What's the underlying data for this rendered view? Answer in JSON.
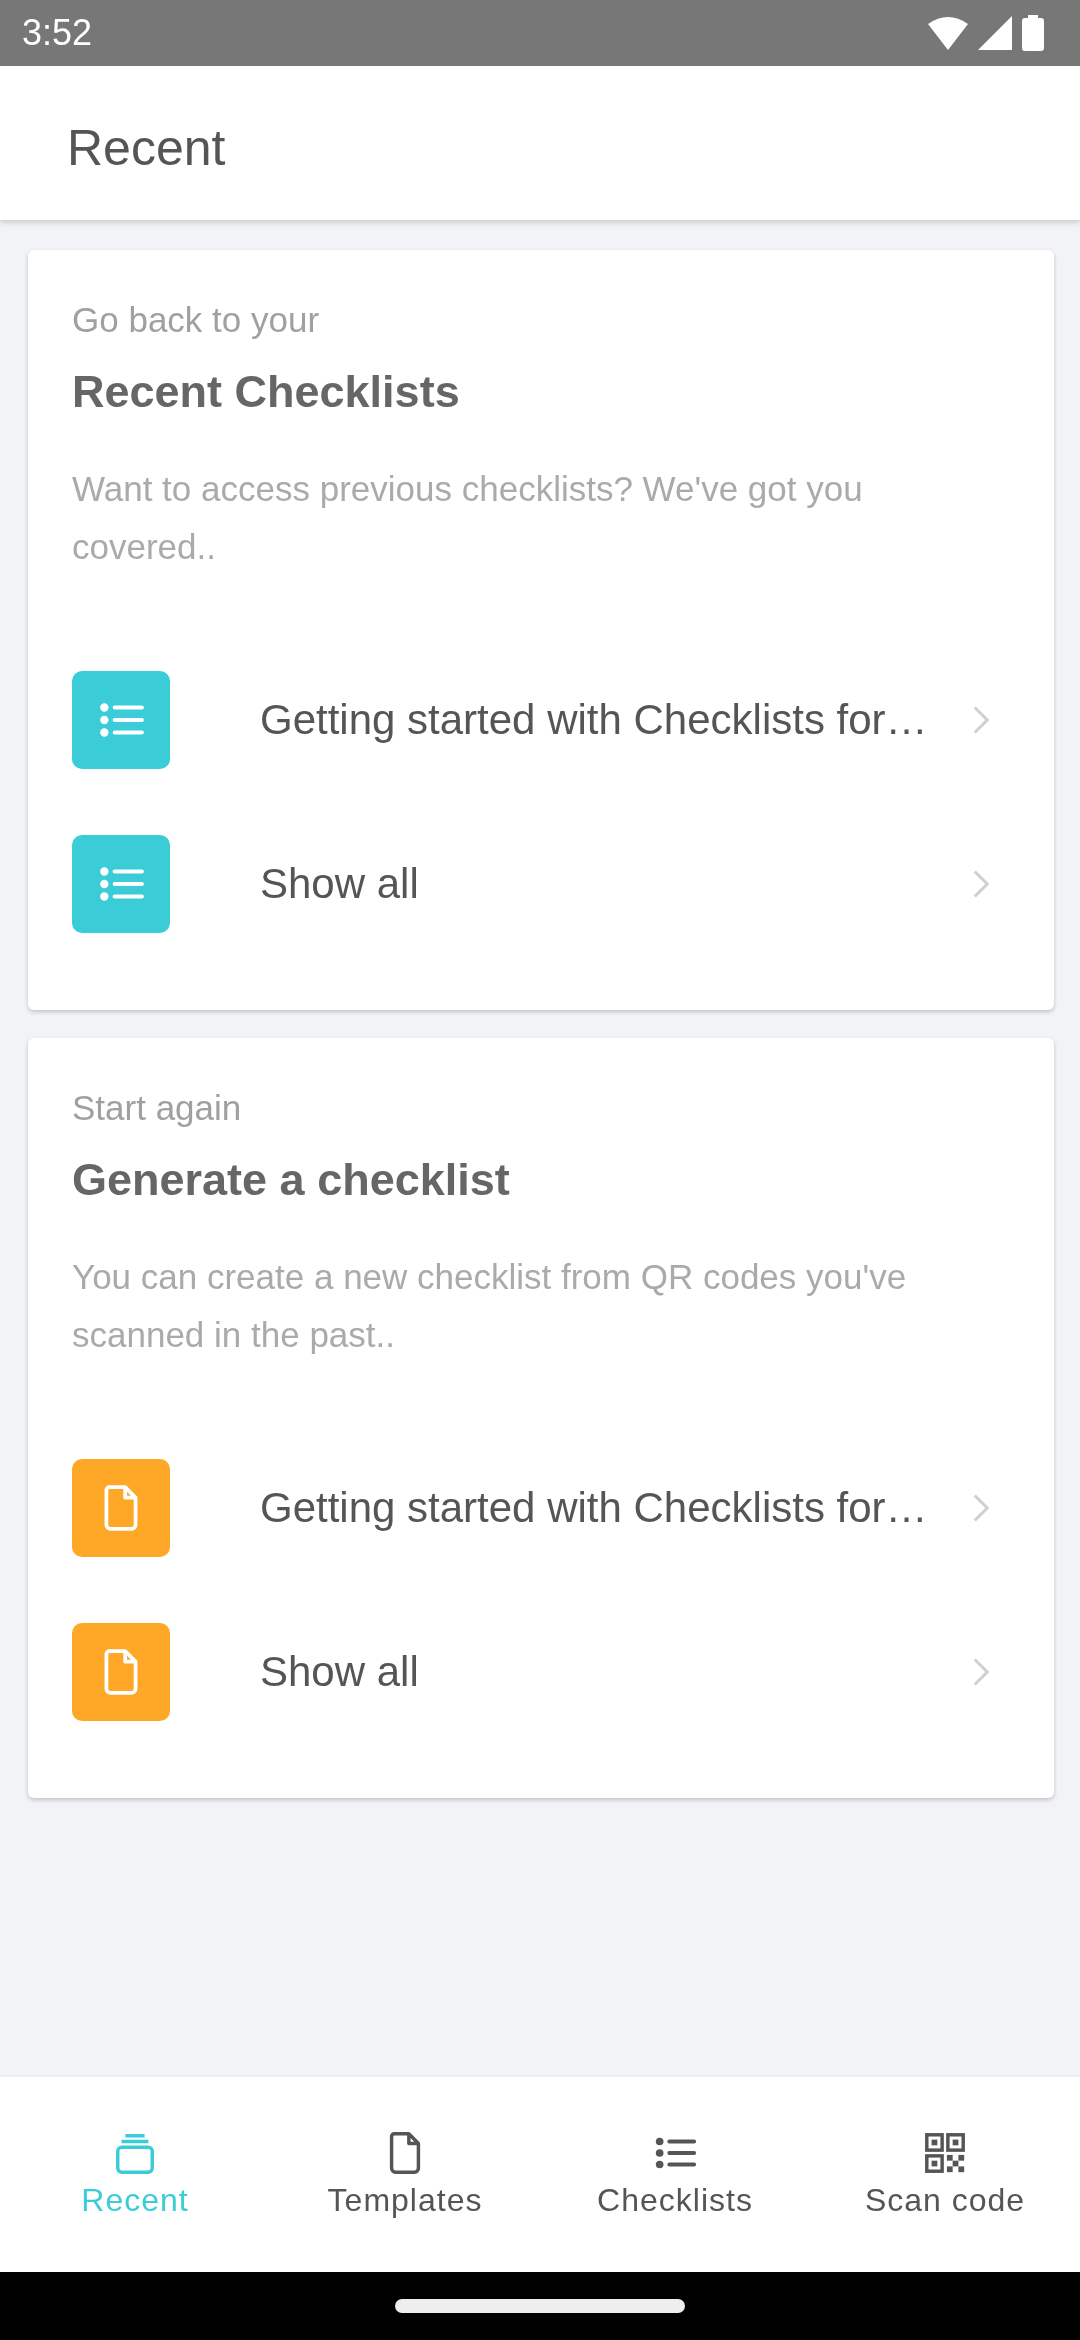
{
  "status_bar": {
    "time": "3:52"
  },
  "header": {
    "title": "Recent"
  },
  "cards": [
    {
      "overline": "Go back to your",
      "title": "Recent Checklists",
      "description": "Want to access previous checklists? We've got you covered..",
      "color": "#3bcdd7",
      "items": [
        {
          "label": "Getting started with Checklists for…"
        },
        {
          "label": "Show all"
        }
      ]
    },
    {
      "overline": "Start again",
      "title": "Generate a checklist",
      "description": "You can create a new checklist from QR codes you've scanned in the past..",
      "color": "#ffa726",
      "items": [
        {
          "label": "Getting started with Checklists for…"
        },
        {
          "label": "Show all"
        }
      ]
    }
  ],
  "nav": [
    {
      "label": "Recent",
      "selected": true
    },
    {
      "label": "Templates",
      "selected": false
    },
    {
      "label": "Checklists",
      "selected": false
    },
    {
      "label": "Scan code",
      "selected": false
    }
  ]
}
